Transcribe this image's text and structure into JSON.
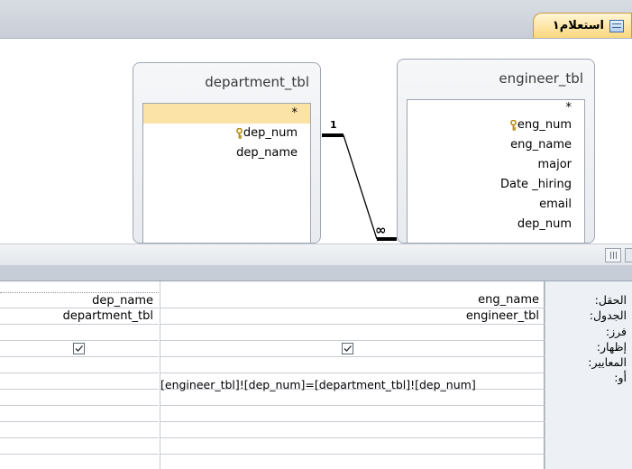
{
  "tab": {
    "title": "استعلام١",
    "icon": "query-table-icon"
  },
  "tables": {
    "department": {
      "name": "department_tbl",
      "fields": [
        "*",
        "dep_num",
        "dep_name"
      ],
      "key_field": "dep_num"
    },
    "engineer": {
      "name": "engineer_tbl",
      "fields": [
        "*",
        "eng_num",
        "eng_name",
        "major",
        "Date _hiring",
        "email",
        "dep_num"
      ],
      "key_field": "eng_num"
    }
  },
  "relationship": {
    "one_label": "1",
    "many_label": "∞"
  },
  "grid": {
    "row_labels": {
      "field": "الحقل:",
      "table": "الجدول:",
      "sort": "فرز:",
      "show": "إظهار:",
      "criteria": "المعايير:",
      "or": "أو:"
    },
    "columns": [
      {
        "field": "eng_name",
        "table": "engineer_tbl",
        "show": true,
        "criteria": "[engineer_tbl]![dep_num]=[department_tbl]![dep_num]"
      },
      {
        "field": "dep_name",
        "table": "department_tbl",
        "show": true,
        "criteria": ""
      }
    ]
  }
}
